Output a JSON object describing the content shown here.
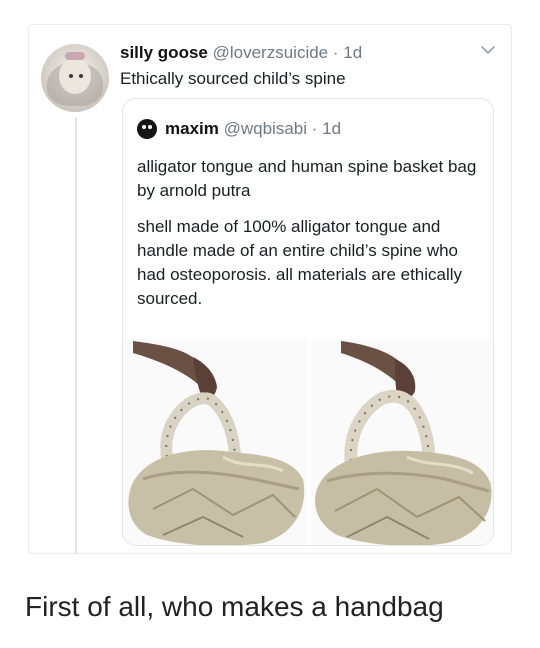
{
  "tweet": {
    "user_name": "silly goose",
    "user_handle": "@loverzsuicide",
    "time": "1d",
    "text": "Ethically sourced child’s spine"
  },
  "quoted_tweet": {
    "user_name": "maxim",
    "user_handle": "@wqbisabi",
    "time": "1d",
    "paragraphs": [
      "alligator tongue and human spine basket bag by arnold putra",
      "shell made of 100% alligator tongue and handle made of an entire child’s spine who had osteoporosis. all materials are ethically sourced."
    ]
  },
  "caption": "First of all, who makes a handbag",
  "icons": {
    "chevron": "chevron-down-icon",
    "separator": "·"
  },
  "colors": {
    "thread_line": "#d8e4ef",
    "meta_text": "#6f7a83",
    "card_border": "#e2e6ea"
  }
}
